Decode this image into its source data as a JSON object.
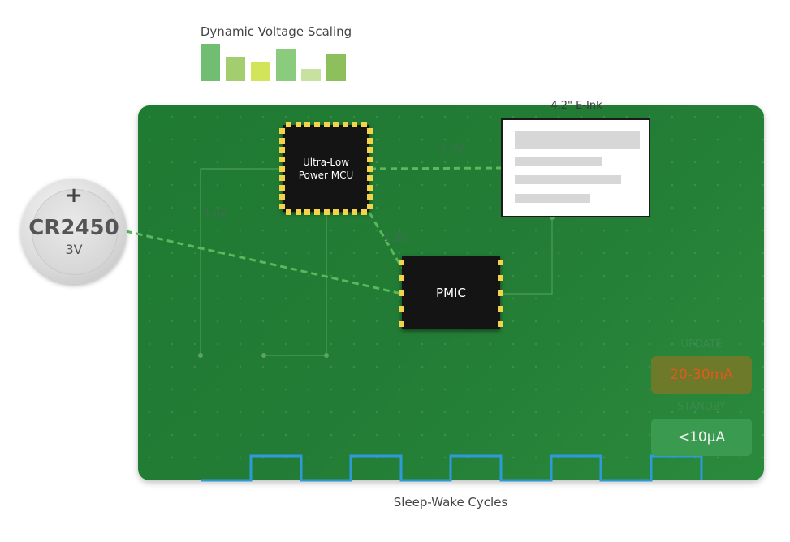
{
  "dvs": {
    "title": "Dynamic Voltage Scaling",
    "levels": [
      0.92,
      0.6,
      0.46,
      0.78,
      0.3,
      0.68
    ],
    "colors": [
      "#71bd72",
      "#a3ce6f",
      "#d2e45a",
      "#8acb7e",
      "#c7e2a0",
      "#8dc05c"
    ]
  },
  "battery": {
    "plus": "+",
    "model": "CR2450",
    "voltage": "3V"
  },
  "mcu": {
    "line1": "Ultra-Low",
    "line2": "Power MCU"
  },
  "pmic": {
    "label": "PMIC"
  },
  "eink": {
    "label": "4.2\" E-Ink"
  },
  "rails": {
    "v33": "3.3V",
    "v30": "3.0V",
    "v18": "1.8V"
  },
  "current": {
    "update_label": "UPDATE",
    "update_value": "20-30mA",
    "standby_label": "STANDBY",
    "standby_value": "<10µA"
  },
  "cycles": {
    "label": "Sleep-Wake Cycles"
  },
  "colors": {
    "board": "#237c35",
    "trace": "#5cb85c",
    "pulse": "#2f9ad9",
    "pin": "#f2d34a"
  }
}
